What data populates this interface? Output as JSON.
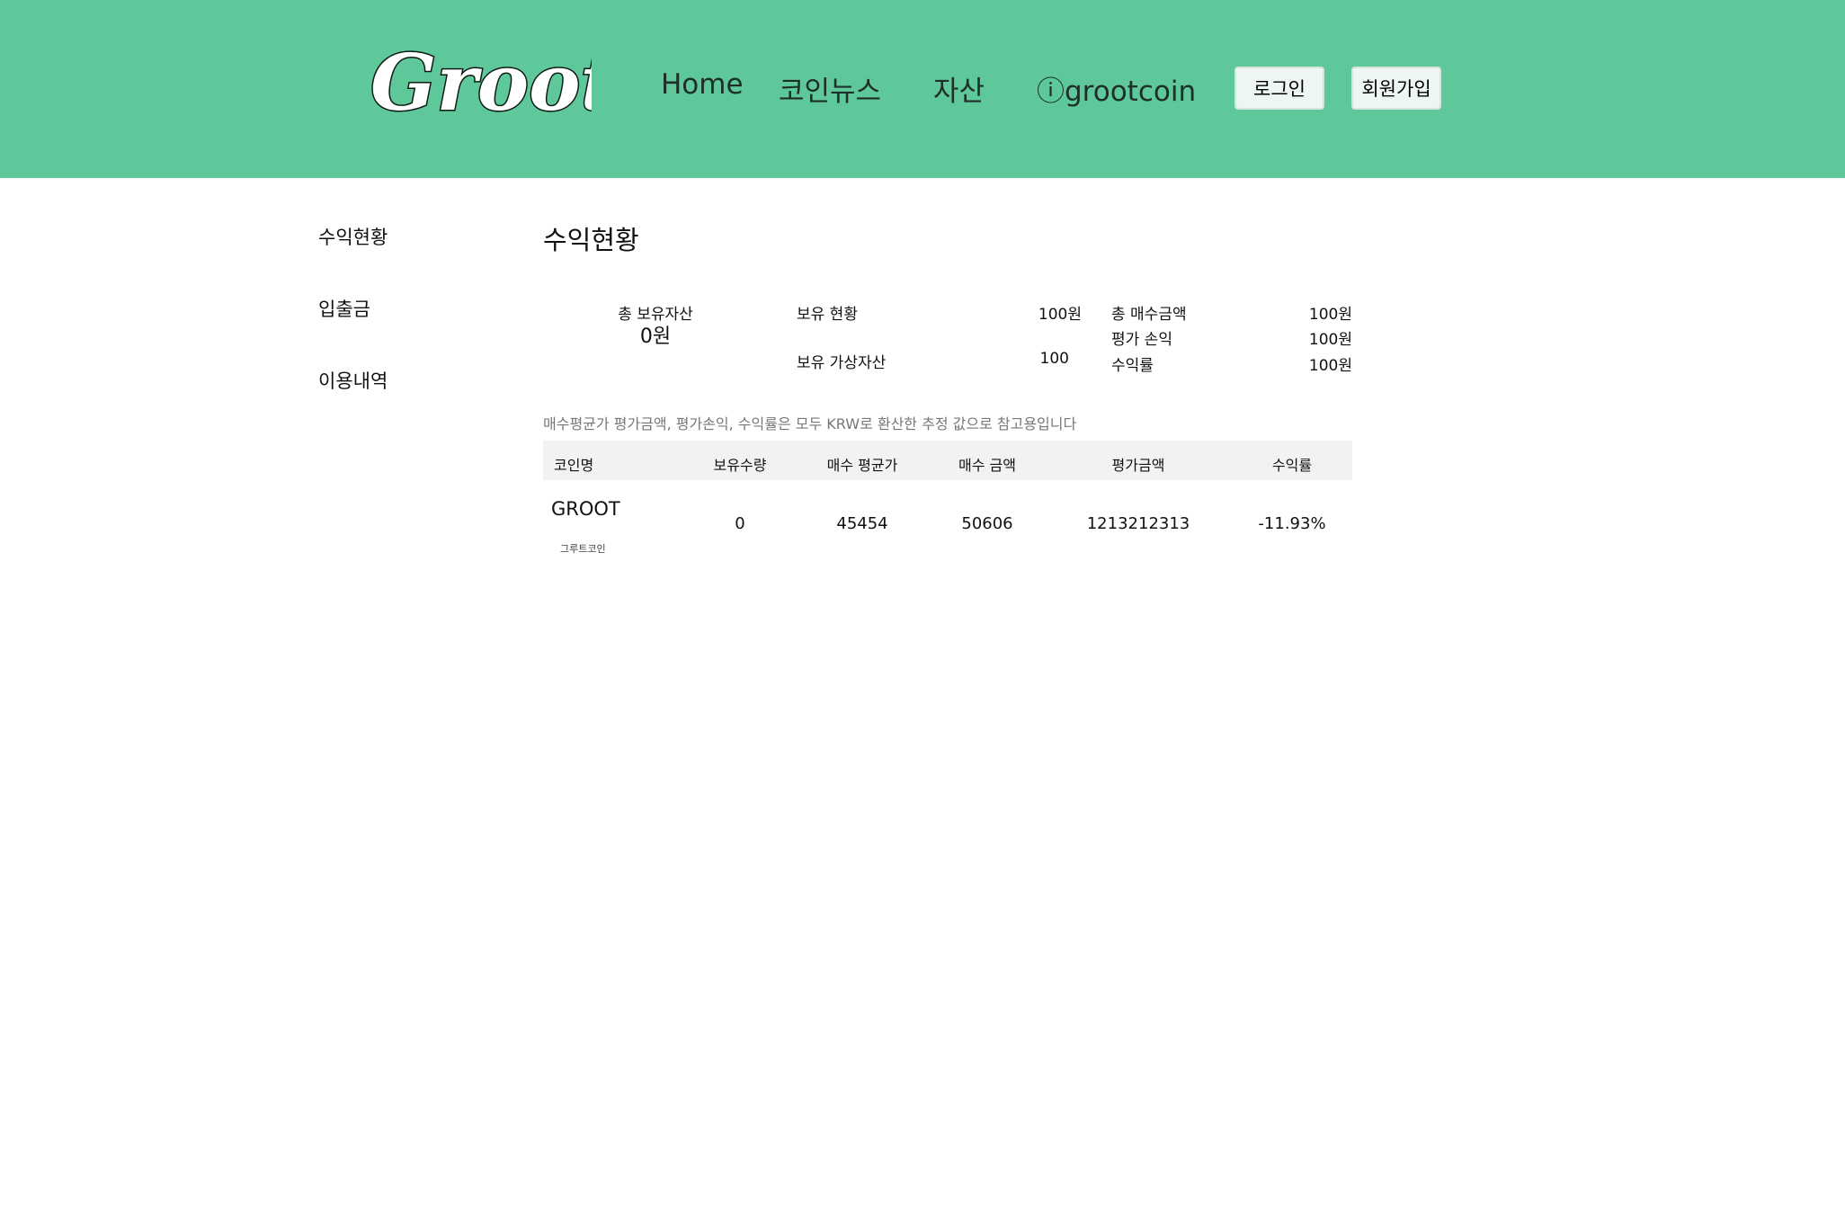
{
  "header": {
    "logo_text": "Groot",
    "nav": [
      "Home",
      "코인뉴스",
      "자산",
      "ⓘgrootcoin"
    ],
    "login_label": "로그인",
    "signup_label": "회원가입",
    "bg_color": "#5ec89b"
  },
  "sidebar": {
    "items": [
      "수익현황",
      "입출금",
      "이용내역"
    ]
  },
  "main": {
    "title": "수익현황",
    "summary": {
      "total_label": "총 보유자산",
      "total_value": "0원",
      "holding_label": "보유 현황",
      "holding_value": "100원",
      "virtual_label": "보유 가상자산",
      "virtual_value": "100",
      "buy_total_label": "총 매수금액",
      "buy_total_value": "100원",
      "eval_pl_label": "평가 손익",
      "eval_pl_value": "100원",
      "return_label": "수익률",
      "return_value": "100원"
    },
    "notice": "매수평균가 평가금액, 평가손익, 수익률은 모두 KRW로 환산한 추정 값으로 참고용입니다",
    "table": {
      "headers": [
        "코인명",
        "보유수량",
        "매수 평균가",
        "매수 금액",
        "평가금액",
        "수익률"
      ],
      "rows": [
        {
          "name": "GROOT",
          "subname": "그루트코인",
          "qty": "0",
          "avg_price": "45454",
          "buy_amount": "50606",
          "eval_amount": "1213212313",
          "return_rate": "-11.93%"
        }
      ]
    }
  }
}
